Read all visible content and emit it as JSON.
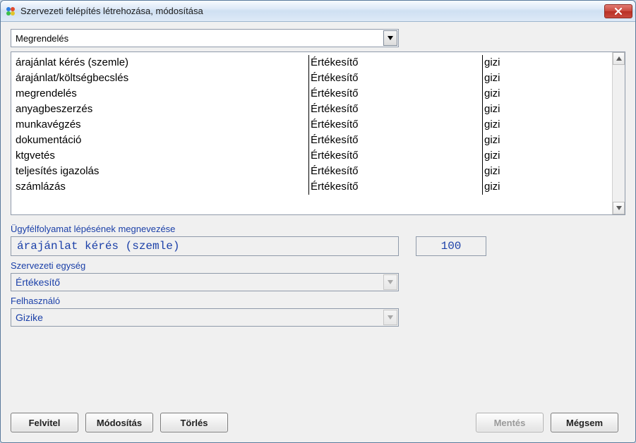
{
  "window": {
    "title": "Szervezeti felépítés létrehozása, módosítása"
  },
  "topDropdown": {
    "selected": "Megrendelés"
  },
  "list": {
    "rows": [
      {
        "c1": "árajánlat kérés (szemle)",
        "c2": "Értékesítő",
        "c3": "gizi"
      },
      {
        "c1": "árajánlat/költségbecslés",
        "c2": "Értékesítő",
        "c3": "gizi"
      },
      {
        "c1": "megrendelés",
        "c2": "Értékesítő",
        "c3": "gizi"
      },
      {
        "c1": "anyagbeszerzés",
        "c2": "Értékesítő",
        "c3": "gizi"
      },
      {
        "c1": "munkavégzés",
        "c2": "Értékesítő",
        "c3": "gizi"
      },
      {
        "c1": "dokumentáció",
        "c2": "Értékesítő",
        "c3": "gizi"
      },
      {
        "c1": "ktgvetés",
        "c2": "Értékesítő",
        "c3": "gizi"
      },
      {
        "c1": "teljesítés igazolás",
        "c2": "Értékesítő",
        "c3": "gizi"
      },
      {
        "c1": "számlázás",
        "c2": "Értékesítő",
        "c3": "gizi"
      }
    ]
  },
  "form": {
    "stepLabel": "Ügyfélfolyamat lépésének megnevezése",
    "stepValue": "árajánlat kérés (szemle)",
    "numberValue": "100",
    "orgUnitLabel": "Szervezeti egység",
    "orgUnitValue": "Értékesítő",
    "userLabel": "Felhasználó",
    "userValue": "Gizike"
  },
  "buttons": {
    "felvitel": "Felvitel",
    "modositas": "Módosítás",
    "torles": "Törlés",
    "mentes": "Mentés",
    "megsem": "Mégsem"
  }
}
